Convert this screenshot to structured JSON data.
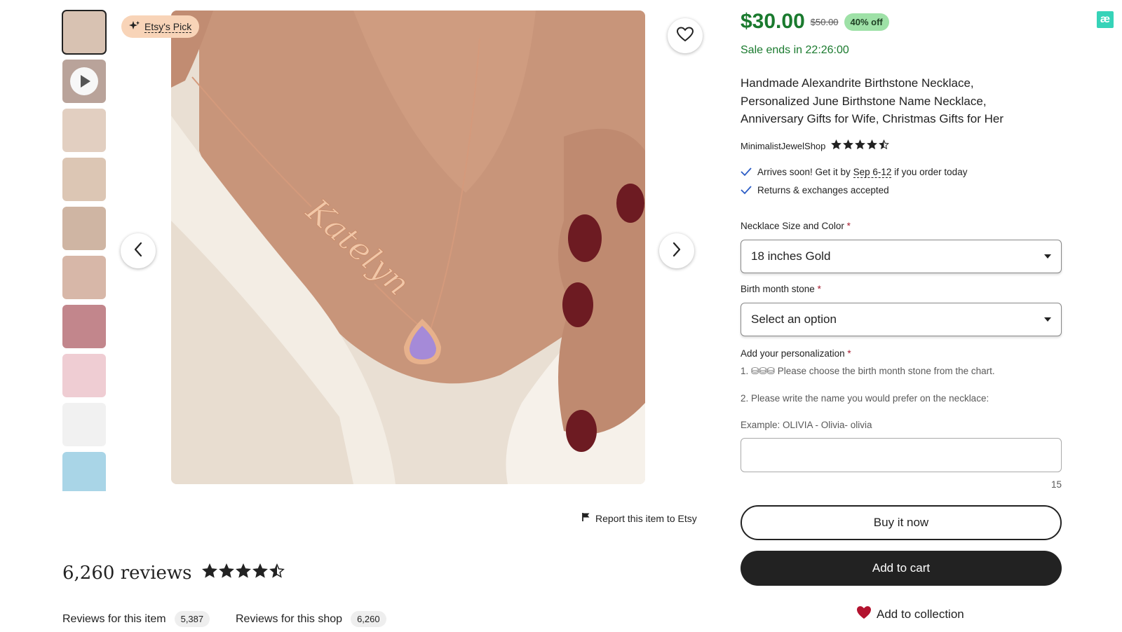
{
  "badge": {
    "label": "Etsy's Pick"
  },
  "thumbnails": [
    {
      "kind": "photo",
      "selected": true,
      "color": "#d8c2b2"
    },
    {
      "kind": "video",
      "selected": false,
      "color": "#b9a39a"
    },
    {
      "kind": "photo",
      "selected": false,
      "color": "#e2cfc1"
    },
    {
      "kind": "photo",
      "selected": false,
      "color": "#dcc6b4"
    },
    {
      "kind": "photo",
      "selected": false,
      "color": "#cfb5a3"
    },
    {
      "kind": "photo",
      "selected": false,
      "color": "#d7b7a8"
    },
    {
      "kind": "photo",
      "selected": false,
      "color": "#c2868c"
    },
    {
      "kind": "photo",
      "selected": false,
      "color": "#efcdd3"
    },
    {
      "kind": "photo",
      "selected": false,
      "color": "#f1f1f1"
    },
    {
      "kind": "photo",
      "selected": false,
      "color": "#a9d5e7"
    }
  ],
  "main_image": {
    "necklace_text": "Katelyn",
    "colors": {
      "skin": "#c8957a",
      "blouse": "#f3ede4",
      "chain": "#d49a7c",
      "stone": "#a58ad8",
      "nails": "#6d1b22"
    }
  },
  "report": {
    "label": "Report this item to Etsy"
  },
  "reviews": {
    "title": "6,260 reviews",
    "rating": 4.5,
    "tabs": [
      {
        "label": "Reviews for this item",
        "count": "5,387"
      },
      {
        "label": "Reviews for this shop",
        "count": "6,260"
      }
    ]
  },
  "product": {
    "price": "$30.00",
    "original_price": "$50.00",
    "discount": "40% off",
    "sale_prefix": "Sale ends in",
    "sale_time": "22:26:00",
    "title_lines": [
      "Handmade Alexandrite Birthstone Necklace,",
      "Personalized June Birthstone Name Necklace,",
      "Anniversary Gifts for Wife, Christmas Gifts for Her"
    ],
    "shop_name": "MinimalistJewelShop",
    "shop_rating": 4.5,
    "shipping_prefix": "Arrives soon! Get it by",
    "shipping_dates": "Sep 6-12",
    "shipping_suffix": "if you order today",
    "returns": "Returns & exchanges accepted"
  },
  "options": {
    "size_label": "Necklace Size and Color",
    "size_value": "18 inches Gold",
    "stone_label": "Birth month stone",
    "stone_value": "Select an option",
    "required_mark": "*"
  },
  "personalization": {
    "label": "Add your personalization",
    "line1": "1. ⛁⛁⛁ Please choose the birth month stone from the chart.",
    "line2": "2. Please write the name you would prefer on the necklace:",
    "example": "Example: OLIVIA - Olivia- olivia",
    "value": "",
    "char_count": "15"
  },
  "actions": {
    "buy_now": "Buy it now",
    "add_to_cart": "Add to cart",
    "add_to_collection": "Add to collection"
  },
  "extension_icon": {
    "glyph": "æ",
    "color": "#36d3b8"
  },
  "accent": {
    "green": "#1a7a2e",
    "badge_green": "#9ee1a7",
    "heart_red": "#b3132f",
    "pick_peach": "#f8d4b8"
  }
}
